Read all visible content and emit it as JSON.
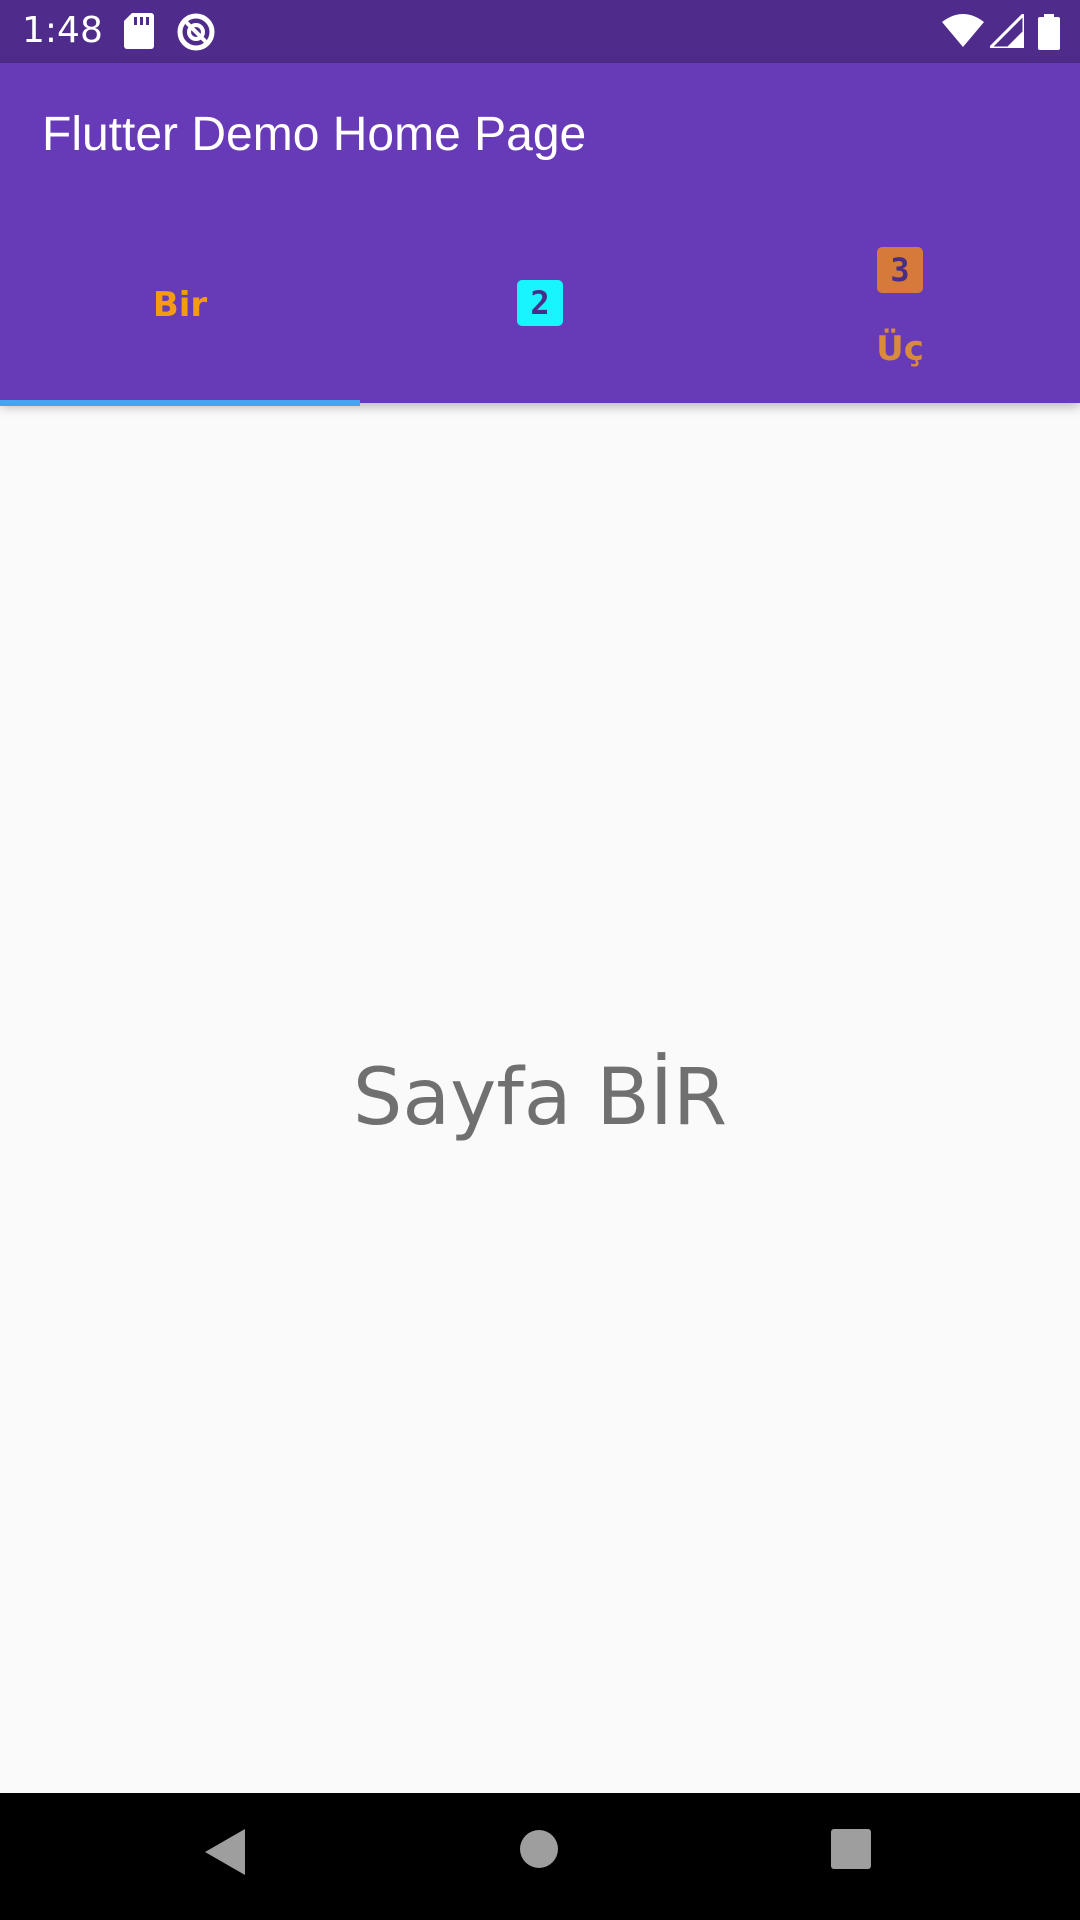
{
  "status_bar": {
    "time": "1:48",
    "icons": [
      "sd-card-icon",
      "data-saver-icon",
      "wifi-icon",
      "signal-icon",
      "battery-icon"
    ]
  },
  "app_bar": {
    "title": "Flutter Demo Home Page",
    "background": "#673ab7"
  },
  "tabs": [
    {
      "label": "Bir",
      "color": "#f39c12",
      "selected": true
    },
    {
      "badge": "2",
      "badge_color": "#18f5ff"
    },
    {
      "badge": "3",
      "badge_color": "#d67a3b",
      "label": "Üç",
      "color": "#d98a3a"
    }
  ],
  "tab_indicator_color": "#42a5f5",
  "content": {
    "text": "Sayfa BİR"
  },
  "nav_bar": {
    "buttons": [
      "back-icon",
      "home-icon",
      "recent-apps-icon"
    ]
  }
}
